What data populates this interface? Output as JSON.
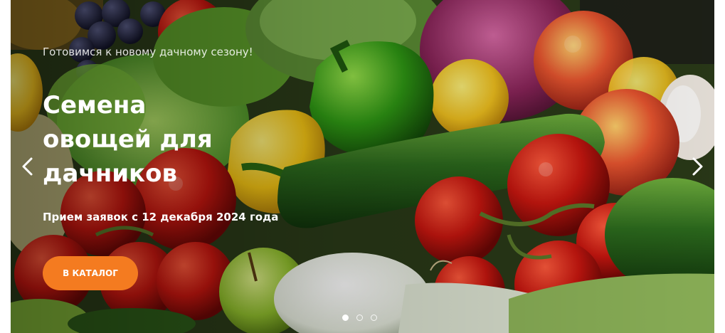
{
  "slider": {
    "active_index": 0,
    "slides_count": 3,
    "caption": {
      "subtitle": "Готовимся к новому дачному сезону!",
      "title": "Семена овощей для дачников",
      "date_line": "Прием заявок с 12 декабря 2024 года",
      "cta_label": "В КАТАЛОГ"
    },
    "colors": {
      "cta": "#f47b20",
      "text": "#ffffff"
    },
    "icons": {
      "prev": "chevron-left-icon",
      "next": "chevron-right-icon"
    }
  }
}
